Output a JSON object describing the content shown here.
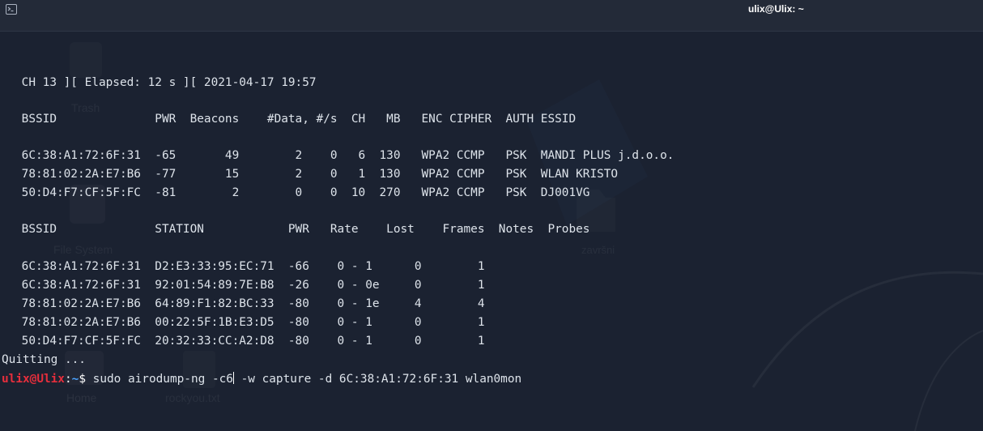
{
  "window": {
    "title": "ulix@Ulix: ~",
    "icon": "terminal-icon"
  },
  "desktop_ghost_labels": {
    "trash": "Trash",
    "file_system": "File System",
    "zavrsni": "završni",
    "home": "Home",
    "rockyou": "rockyou.txt"
  },
  "terminal": {
    "status_line": " CH 13 ][ Elapsed: 12 s ][ 2021-04-17 19:57",
    "ap_header": " BSSID              PWR  Beacons    #Data, #/s  CH   MB   ENC CIPHER  AUTH ESSID",
    "ap_rows": [
      " 6C:38:A1:72:6F:31  -65       49        2    0   6  130   WPA2 CCMP   PSK  MANDI PLUS j.d.o.o.",
      " 78:81:02:2A:E7:B6  -77       15        2    0   1  130   WPA2 CCMP   PSK  WLAN KRISTO",
      " 50:D4:F7:CF:5F:FC  -81        2        0    0  10  270   WPA2 CCMP   PSK  DJ001VG"
    ],
    "station_header": " BSSID              STATION            PWR   Rate    Lost    Frames  Notes  Probes",
    "station_rows": [
      " 6C:38:A1:72:6F:31  D2:E3:33:95:EC:71  -66    0 - 1      0        1",
      " 6C:38:A1:72:6F:31  92:01:54:89:7E:B8  -26    0 - 0e     0        1",
      " 78:81:02:2A:E7:B6  64:89:F1:82:BC:33  -80    0 - 1e     4        4",
      " 78:81:02:2A:E7:B6  00:22:5F:1B:E3:D5  -80    0 - 1      0        1",
      " 50:D4:F7:CF:5F:FC  20:32:33:CC:A2:D8  -80    0 - 1      0        1"
    ],
    "quitting": "Quitting ...",
    "prompt": {
      "user_host": "ulix@Ulix",
      "separator": ":",
      "path": "~",
      "symbol": "$",
      "command_before_cursor": " sudo airodump-ng -c6",
      "command_after_cursor": " -w capture -d 6C:38:A1:72:6F:31 wlan0mon"
    }
  },
  "colors": {
    "background": "#1b2231",
    "titlebar": "#232a38",
    "text": "#dde3ea",
    "prompt_user": "#e62e3c",
    "prompt_path": "#4ba3ff"
  }
}
